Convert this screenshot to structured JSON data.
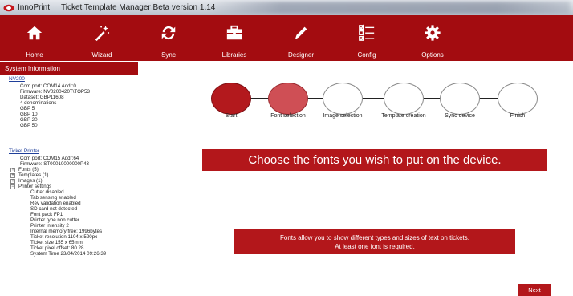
{
  "window": {
    "app_name": "InnoPrint",
    "title": "Ticket Template Manager Beta version 1.14"
  },
  "toolbar": [
    {
      "label": "Home",
      "icon": "home-icon"
    },
    {
      "label": "Wizard",
      "icon": "wizard-wand-icon"
    },
    {
      "label": "Sync",
      "icon": "sync-icon"
    },
    {
      "label": "Libraries",
      "icon": "toolbox-icon"
    },
    {
      "label": "Designer",
      "icon": "pencil-icon"
    },
    {
      "label": "Config",
      "icon": "checklist-icon"
    },
    {
      "label": "Options",
      "icon": "gear-icon"
    }
  ],
  "system_info": {
    "header": "System Information",
    "nv200": {
      "title": "NV200",
      "lines": [
        "Com port: COM14 Addr:0",
        "Firmware: NV0200420T\\TOP53",
        "Dataset: GBP11608",
        "4 denominations",
        "GBP 5",
        "GBP 10",
        "GBP 20",
        "GBP 50"
      ]
    },
    "printer": {
      "title": "Ticket Printer",
      "lines": [
        "Com port: COM15 Addr:64",
        "Firmware: ST00010000000P43"
      ],
      "tree": [
        {
          "label": "Fonts (5)",
          "toggle": "+"
        },
        {
          "label": "Templates (1)",
          "toggle": "+"
        },
        {
          "label": "Images (1)",
          "toggle": "+"
        },
        {
          "label": "Printer settings",
          "toggle": "−"
        }
      ],
      "settings": [
        "Cutter disabled",
        "Tab sensing enabled",
        "Rev validation enabled",
        "SD card not detected",
        "Font pack FP1",
        "Printer type non cutter",
        "Printer intensity 2",
        "Internal memory free: 1996bytes",
        "Ticket resolution 1104 x 520px",
        "Ticket size 155 x 65mm",
        "Ticket pixel offset: 80.28",
        "System Time 23/04/2014 09:26:39"
      ]
    }
  },
  "wizard": {
    "steps": [
      {
        "label": "Start",
        "state": "done"
      },
      {
        "label": "Font selection",
        "state": "active"
      },
      {
        "label": "Image selection",
        "state": "pending"
      },
      {
        "label": "Template creation",
        "state": "pending"
      },
      {
        "label": "Sync device",
        "state": "pending"
      },
      {
        "label": "Finish",
        "state": "pending"
      }
    ],
    "heading": "Choose the fonts you wish to put on the device.",
    "info_line1": "Fonts allow you to show different types and sizes of text on tickets.",
    "info_line2": "At least one font is required.",
    "next_label": "Next"
  },
  "colors": {
    "accent": "#a30c10",
    "step_done": "#b3191d",
    "step_active": "#cf4f55"
  }
}
